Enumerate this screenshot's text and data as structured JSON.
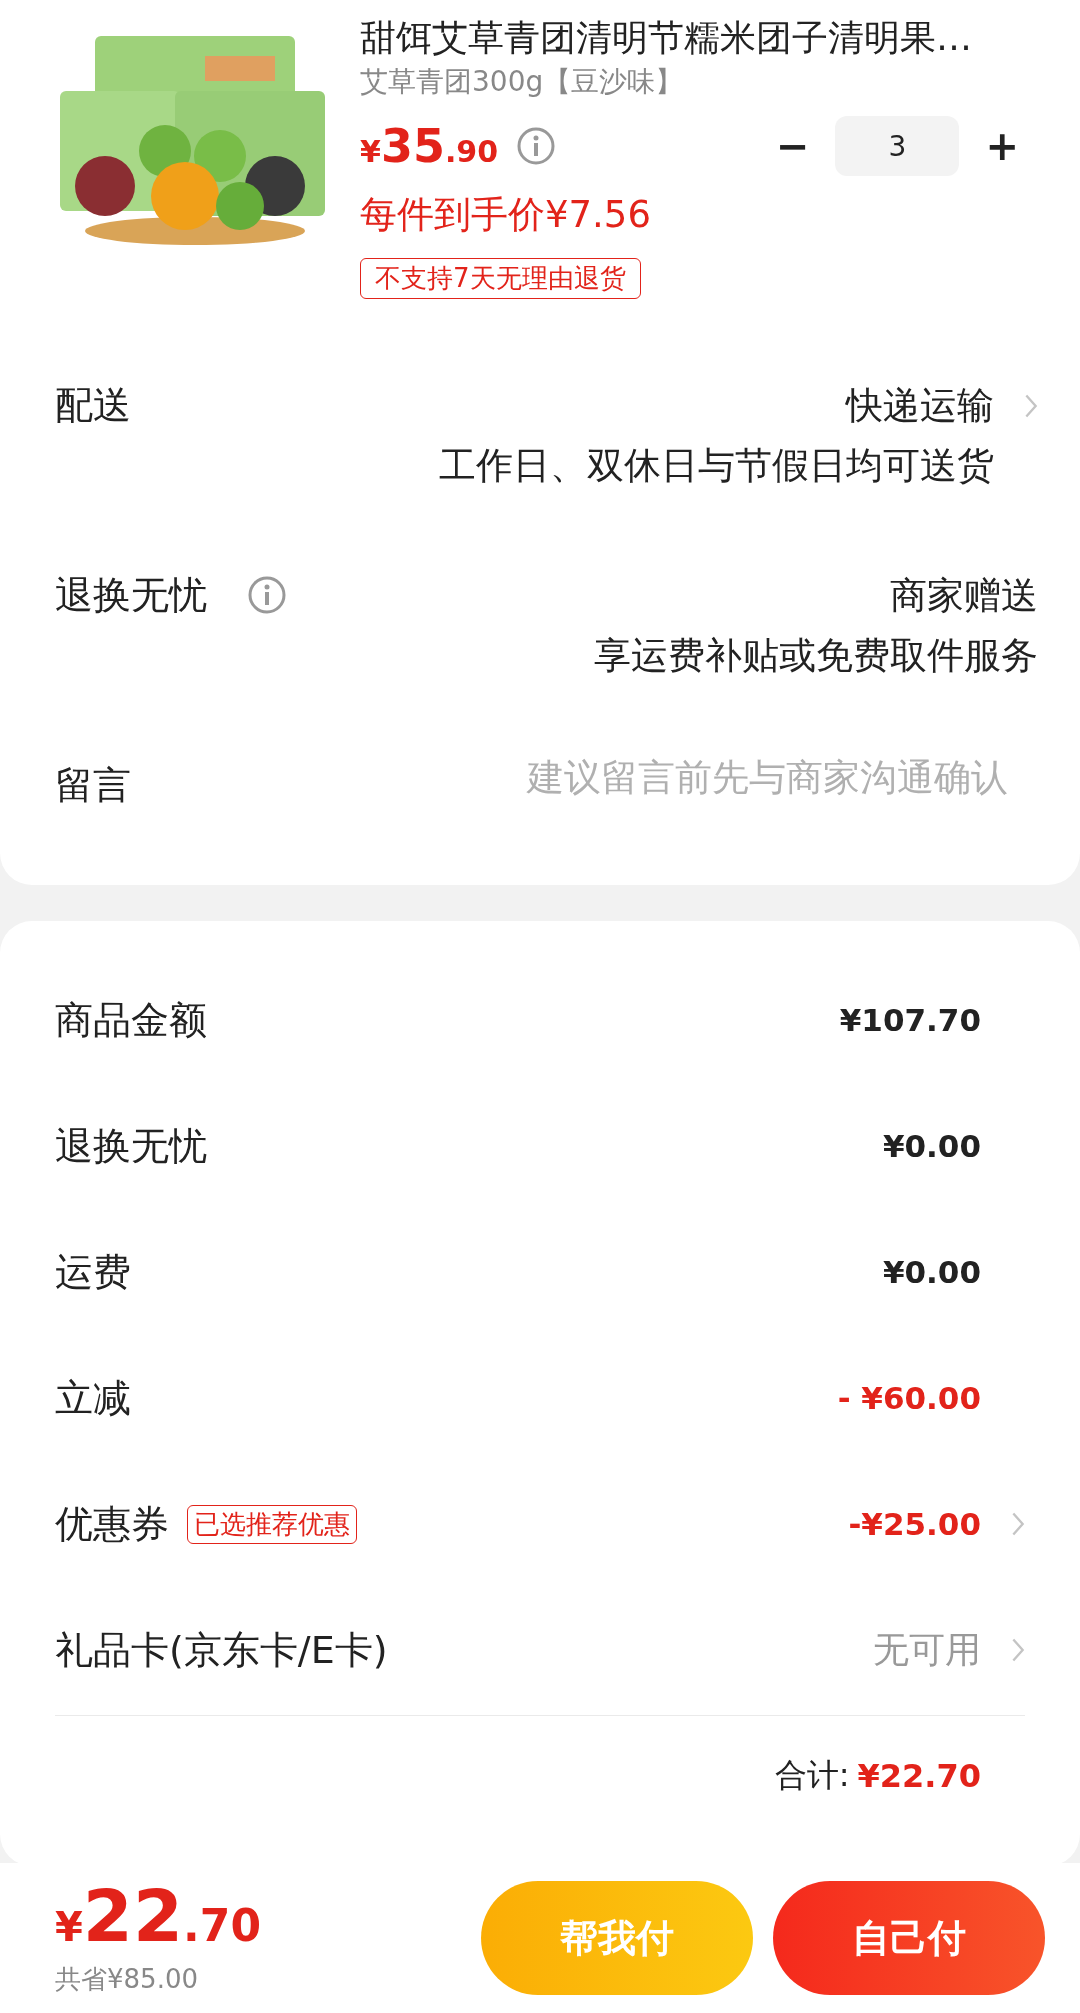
{
  "product": {
    "title": "甜饵艾草青团清明节糯米团子清明果…",
    "spec": "艾草青团300g【豆沙味】",
    "price_symbol": "¥",
    "price_int": "35",
    "price_dec": ".90",
    "unit_price": "每件到手价¥7.56",
    "tag": "不支持7天无理由退货",
    "quantity": "3",
    "minus": "−",
    "plus": "+"
  },
  "options": [
    {
      "label": "配送",
      "has_info": false,
      "lines": [
        "快递运输",
        "工作日、双休日与节假日均可送货"
      ],
      "has_arrow": true,
      "kind": "value"
    },
    {
      "label": "退换无忧",
      "has_info": true,
      "lines": [
        "商家赠送",
        "享运费补贴或免费取件服务"
      ],
      "has_arrow": false,
      "kind": "value"
    },
    {
      "label": "留言",
      "has_info": false,
      "placeholder": "建议留言前先与商家沟通确认",
      "has_arrow": false,
      "kind": "input"
    }
  ],
  "summary": [
    {
      "label": "商品金额",
      "value": "¥107.70",
      "kind": "amount",
      "has_arrow": false
    },
    {
      "label": "退换无忧",
      "value": "¥0.00",
      "kind": "amount",
      "has_arrow": false
    },
    {
      "label": "运费",
      "value": "¥0.00",
      "kind": "amount",
      "has_arrow": false
    },
    {
      "label": "立减",
      "value": "- ¥60.00",
      "kind": "discount",
      "has_arrow": false
    },
    {
      "label": "优惠券",
      "tag": "已选推荐优惠",
      "value": "-¥25.00",
      "kind": "discount",
      "has_arrow": true
    },
    {
      "label": "礼品卡(京东卡/E卡)",
      "value": "无可用",
      "kind": "unavailable",
      "has_arrow": true
    }
  ],
  "total": {
    "label": "合计:",
    "value": "¥22.70"
  },
  "footer": {
    "price_symbol": "¥",
    "price_int": "22",
    "price_dec": ".70",
    "saved": "共省¥85.00",
    "buttons": [
      {
        "label": "帮我付",
        "kind": "secondary"
      },
      {
        "label": "自己付",
        "kind": "primary"
      }
    ]
  }
}
